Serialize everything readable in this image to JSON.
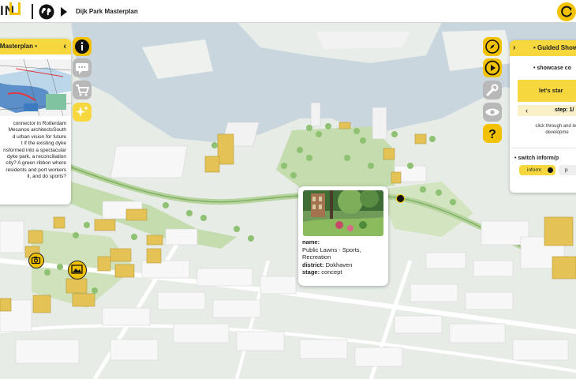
{
  "app": {
    "logo_text": "IN",
    "title": "Dijk Park Masterplan"
  },
  "left_panel": {
    "heading": "rk Masterplan •",
    "body": "connector in Rotterdam\nMecanoo architectsSouth\nd urban vision for future\nt if the existing dyke\nnsformed into a spectacular\ndyke park, a reconciliation\ncity? A green ribbon where\nresidents and port workers\nll, and do sports?"
  },
  "left_tools": [
    {
      "name": "info-icon",
      "color": "#f2c200"
    },
    {
      "name": "chat-icon",
      "color": "#b8b8b8"
    },
    {
      "name": "cart-icon",
      "color": "#b8b8b8"
    },
    {
      "name": "sparkles-icon",
      "color": "#f6d83e"
    }
  ],
  "right_tools": [
    {
      "name": "compass-icon",
      "color": "#f2c200"
    },
    {
      "name": "play-icon",
      "color": "#f2c200"
    },
    {
      "name": "wrench-icon",
      "color": "#b8b8b8"
    },
    {
      "name": "eye-icon",
      "color": "#b8b8b8"
    },
    {
      "name": "question-icon",
      "color": "#f2c200"
    }
  ],
  "guided_show": {
    "heading": "• Guided Show",
    "subheading": "• showcase co",
    "start_label": "let's star",
    "step_label": "step: 1/",
    "help_text": "click through and lea\ndevelopme",
    "switch_label": "• switch inform/p",
    "inform_label": "inform",
    "other_label": "p"
  },
  "popup": {
    "name_key": "name:",
    "name_value": "Public Lawns - Sports, Recreation",
    "district_key": "district:",
    "district_value": "Dokhaven",
    "stage_key": "stage:",
    "stage_value": "concept"
  },
  "colors": {
    "accent": "#f2c200",
    "accent_light": "#f6d83e",
    "water": "#c9d6de",
    "park": "#c4dcae",
    "building": "#f6f6f6",
    "landmark": "#e4c256"
  }
}
